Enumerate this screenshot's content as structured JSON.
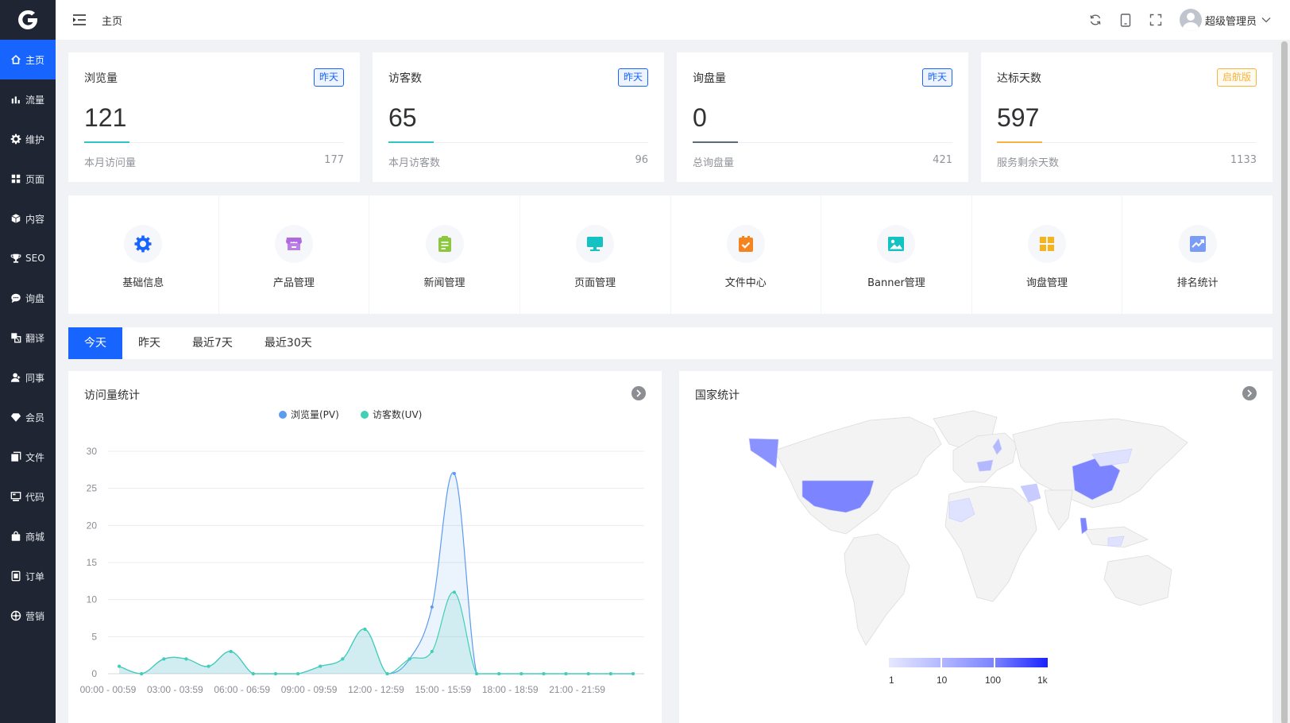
{
  "sidebar": {
    "logo": "G-logo",
    "items": [
      {
        "label": "主页",
        "icon": "home-icon",
        "active": true
      },
      {
        "label": "流量",
        "icon": "bar-chart-icon"
      },
      {
        "label": "维护",
        "icon": "gear-icon"
      },
      {
        "label": "页面",
        "icon": "grid-icon"
      },
      {
        "label": "内容",
        "icon": "cube-icon"
      },
      {
        "label": "SEO",
        "icon": "trophy-icon"
      },
      {
        "label": "询盘",
        "icon": "chat-icon"
      },
      {
        "label": "翻译",
        "icon": "translate-icon"
      },
      {
        "label": "同事",
        "icon": "user-icon"
      },
      {
        "label": "会员",
        "icon": "diamond-icon"
      },
      {
        "label": "文件",
        "icon": "files-icon"
      },
      {
        "label": "代码",
        "icon": "code-icon"
      },
      {
        "label": "商城",
        "icon": "shopping-bag-icon"
      },
      {
        "label": "订单",
        "icon": "order-icon"
      },
      {
        "label": "营销",
        "icon": "marketing-icon"
      }
    ]
  },
  "header": {
    "breadcrumb": "主页",
    "username": "超级管理员",
    "icons": [
      "refresh-icon",
      "mobile-icon",
      "fullscreen-icon"
    ]
  },
  "stats": [
    {
      "title": "浏览量",
      "badge": "昨天",
      "value": "121",
      "foot_label": "本月访问量",
      "foot_value": "177",
      "color": "#2ec7c9"
    },
    {
      "title": "访客数",
      "badge": "昨天",
      "value": "65",
      "foot_label": "本月访客数",
      "foot_value": "96",
      "color": "#2ec7c9"
    },
    {
      "title": "询盘量",
      "badge": "昨天",
      "value": "0",
      "foot_label": "总询盘量",
      "foot_value": "421",
      "color": "#5b6b7d"
    },
    {
      "title": "达标天数",
      "badge": "启航版",
      "value": "597",
      "foot_label": "服务剩余天数",
      "foot_value": "1133",
      "color": "#f5b342"
    }
  ],
  "quick_links": [
    {
      "label": "基础信息",
      "icon": "gear-icon",
      "color": "#1764ff"
    },
    {
      "label": "产品管理",
      "icon": "store-icon",
      "color": "#b06ae0"
    },
    {
      "label": "新闻管理",
      "icon": "clipboard-icon",
      "color": "#8dc63f"
    },
    {
      "label": "页面管理",
      "icon": "monitor-icon",
      "color": "#13c2c2"
    },
    {
      "label": "文件中心",
      "icon": "task-icon",
      "color": "#f5841f"
    },
    {
      "label": "Banner管理",
      "icon": "image-icon",
      "color": "#13c2c2"
    },
    {
      "label": "询盘管理",
      "icon": "apps-icon",
      "color": "#f5b31e"
    },
    {
      "label": "排名统计",
      "icon": "trend-icon",
      "color": "#7b9cf5"
    }
  ],
  "tabs": [
    {
      "label": "今天",
      "active": true
    },
    {
      "label": "昨天"
    },
    {
      "label": "最近7天"
    },
    {
      "label": "最近30天"
    }
  ],
  "visits_panel": {
    "title": "访问量统计"
  },
  "country_panel": {
    "title": "国家统计"
  },
  "chart_data": {
    "type": "area",
    "x": [
      "00:00 - 00:59",
      "01:00 - 01:59",
      "02:00 - 02:59",
      "03:00 - 03:59",
      "04:00 - 04:59",
      "05:00 - 05:59",
      "06:00 - 06:59",
      "07:00 - 07:59",
      "08:00 - 08:59",
      "09:00 - 09:59",
      "10:00 - 10:59",
      "11:00 - 11:59",
      "12:00 - 12:59",
      "13:00 - 13:59",
      "14:00 - 14:59",
      "15:00 - 15:59",
      "16:00 - 16:59",
      "17:00 - 17:59",
      "18:00 - 18:59",
      "19:00 - 19:59",
      "20:00 - 20:59",
      "21:00 - 21:59",
      "22:00 - 22:59",
      "23:00 - 23:59"
    ],
    "xtick_labels": [
      "00:00 - 00:59",
      "03:00 - 03:59",
      "06:00 - 06:59",
      "09:00 - 09:59",
      "12:00 - 12:59",
      "15:00 - 15:59",
      "18:00 - 18:59",
      "21:00 - 21:59"
    ],
    "series": [
      {
        "name": "浏览量(PV)",
        "color": "#5b9bf0",
        "values": [
          1,
          0,
          2,
          2,
          1,
          3,
          0,
          0,
          0,
          1,
          2,
          6,
          0,
          2,
          9,
          27,
          0,
          0,
          0,
          0,
          0,
          0,
          0,
          0
        ]
      },
      {
        "name": "访客数(UV)",
        "color": "#3fd0b5",
        "values": [
          1,
          0,
          2,
          2,
          1,
          3,
          0,
          0,
          0,
          1,
          2,
          6,
          0,
          2,
          3,
          11,
          0,
          0,
          0,
          0,
          0,
          0,
          0,
          0
        ]
      }
    ],
    "ylim": [
      0,
      30
    ],
    "yticks": [
      0,
      5,
      10,
      15,
      20,
      25,
      30
    ],
    "legend": "top-center",
    "grid": true
  },
  "map_legend": {
    "labels": [
      "1",
      "10",
      "100",
      "1k"
    ],
    "colors": [
      "#e6e8ff",
      "#b3b8ff",
      "#7c84ff",
      "#1a23ff"
    ]
  }
}
